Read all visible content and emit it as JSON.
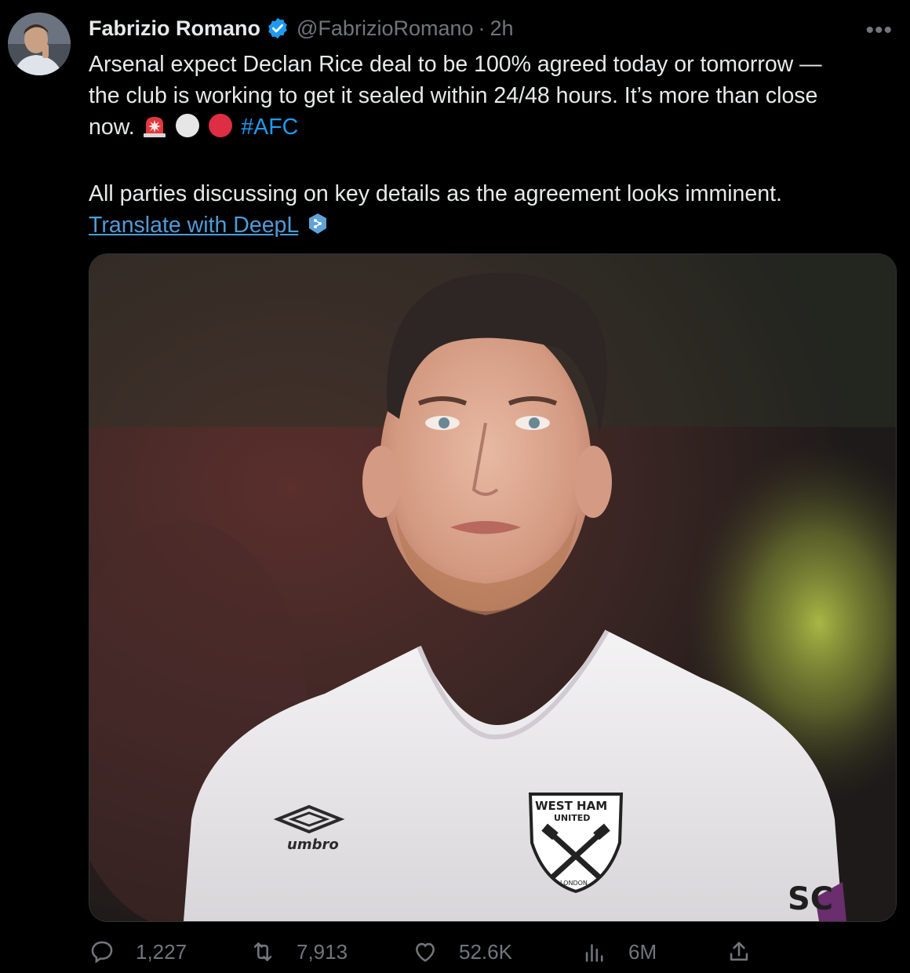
{
  "author": {
    "name": "Fabrizio Romano",
    "handle": "@FabrizioRomano",
    "separator": "·",
    "time": "2h"
  },
  "tweet": {
    "line1": "Arsenal expect Declan Rice deal to be 100% agreed today or tomorrow —",
    "line2": "the club is working to get it sealed within 24/48 hours. It’s more than close",
    "line3_prefix": "now.",
    "hashtag": "#AFC",
    "para2": "All parties discussing on key details as the agreement looks imminent.",
    "translate_link": "Translate with DeepL"
  },
  "icons": {
    "verified": "verified-badge-icon",
    "more": "more-icon",
    "emoji1": "police-light-emoji",
    "emoji2": "white-circle-emoji",
    "emoji3": "red-circle-emoji",
    "deepl": "deepl-icon",
    "reply": "reply-icon",
    "retweet": "retweet-icon",
    "like": "like-icon",
    "views": "views-icon",
    "share": "share-icon"
  },
  "media": {
    "badge_line1": "WEST HAM",
    "badge_line2": "UNITED",
    "badge_line3": "LONDON",
    "kit_brand": "umbro",
    "sleeve_text": "SC"
  },
  "stats": {
    "replies": "1,227",
    "retweets": "7,913",
    "likes": "52.6K",
    "views": "6M"
  },
  "colors": {
    "background": "#000000",
    "text": "#e7e9ea",
    "secondary": "#71767b",
    "link": "#1d9bf0",
    "translate_link": "#4e9bd8",
    "verified": "#1d9bf0"
  }
}
